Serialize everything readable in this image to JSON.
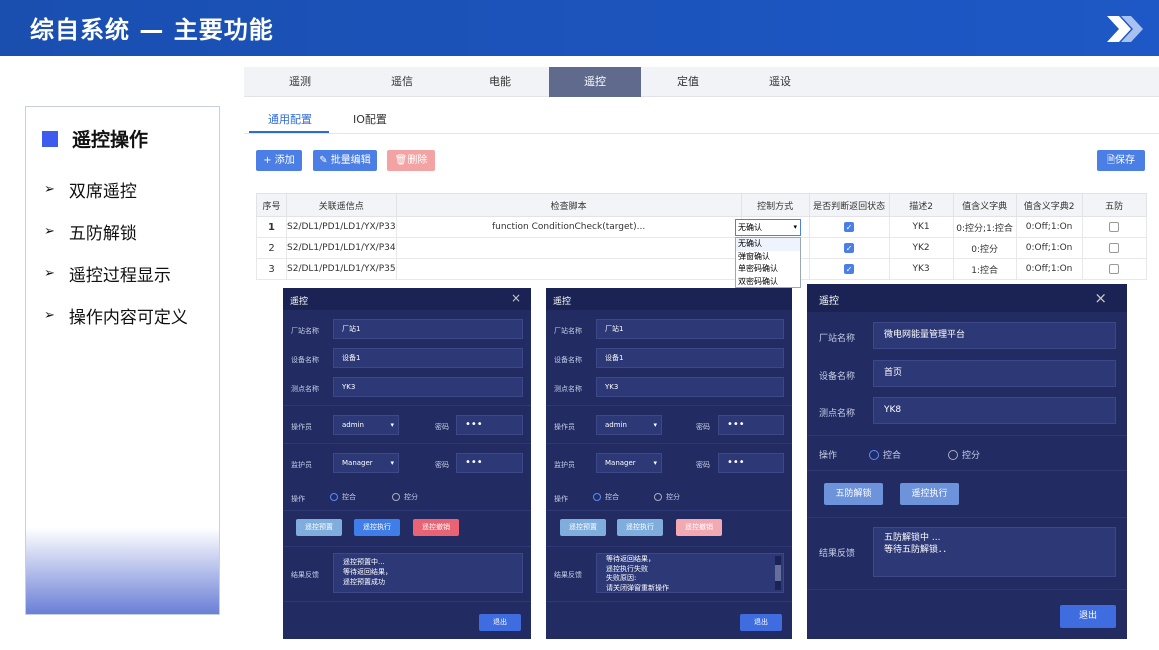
{
  "banner": {
    "title": "综自系统 — 主要功能",
    "icon": "chevron-double-right-icon"
  },
  "left": {
    "heading": "遥控操作",
    "items": [
      "双席遥控",
      "五防解锁",
      "遥控过程显示",
      "操作内容可定义"
    ]
  },
  "tabs": [
    "遥测",
    "遥信",
    "电能",
    "遥控",
    "定值",
    "遥设"
  ],
  "active_tab": "遥控",
  "subtabs": [
    "通用配置",
    "IO配置"
  ],
  "buttons": {
    "add": "+ 添加",
    "batch": "批量编辑",
    "del": "删除",
    "save": "保存"
  },
  "table": {
    "headers": [
      "序号",
      "关联遥信点",
      "检查脚本",
      "控制方式",
      "是否判断返回状态",
      "描述2",
      "值含义字典",
      "值含义字典2",
      "五防"
    ],
    "rows": [
      [
        "1",
        "S2/DL1/PD1/LD1/YX/P33",
        "function ConditionCheck(target)...",
        "无确认",
        "YK1",
        "0:控分;1:控合",
        "0:Off;1:On"
      ],
      [
        "2",
        "S2/DL1/PD1/LD1/YX/P34",
        "",
        "",
        "YK2",
        "0:控分",
        "0:Off;1:On"
      ],
      [
        "3",
        "S2/DL1/PD1/LD1/YX/P35",
        "",
        "",
        "YK3",
        "1:控合",
        "0:Off;1:On"
      ]
    ],
    "select_value": "无确认",
    "dropdown_options": [
      "无确认",
      "弹窗确认",
      "单密码确认",
      "双密码确认"
    ]
  },
  "dialog_common": {
    "title": "遥控",
    "close": "×",
    "station_label": "厂站名称",
    "device_label": "设备名称",
    "point_label": "测点名称",
    "operator_label": "操作员",
    "guardian_label": "监护员",
    "password_label": "密码",
    "op_label": "操作",
    "close_opt": "控合",
    "open_opt": "控分",
    "preset": "遥控预置",
    "execute": "遥控执行",
    "cancel": "遥控撤销",
    "result_label": "结果反馈",
    "exit": "退出",
    "password_mask": "•••"
  },
  "dlg1": {
    "station": "厂站1",
    "device": "设备1",
    "point": "YK3",
    "operator": "admin",
    "guardian": "Manager",
    "result": [
      "遥控预置中...",
      "等待返回结果，",
      "遥控预置成功"
    ]
  },
  "dlg2": {
    "station": "厂站1",
    "device": "设备1",
    "point": "YK3",
    "operator": "admin",
    "guardian": "Manager",
    "result": [
      "等待返回结果，",
      "遥控执行失败",
      "失败原因:",
      "请关闭弹窗重新操作"
    ]
  },
  "dlg3": {
    "station": "微电网能量管理平台",
    "device": "首页",
    "point": "YK8",
    "wufang": "五防解锁",
    "result": [
      "五防解锁中 ...",
      "等待五防解锁．．"
    ]
  }
}
